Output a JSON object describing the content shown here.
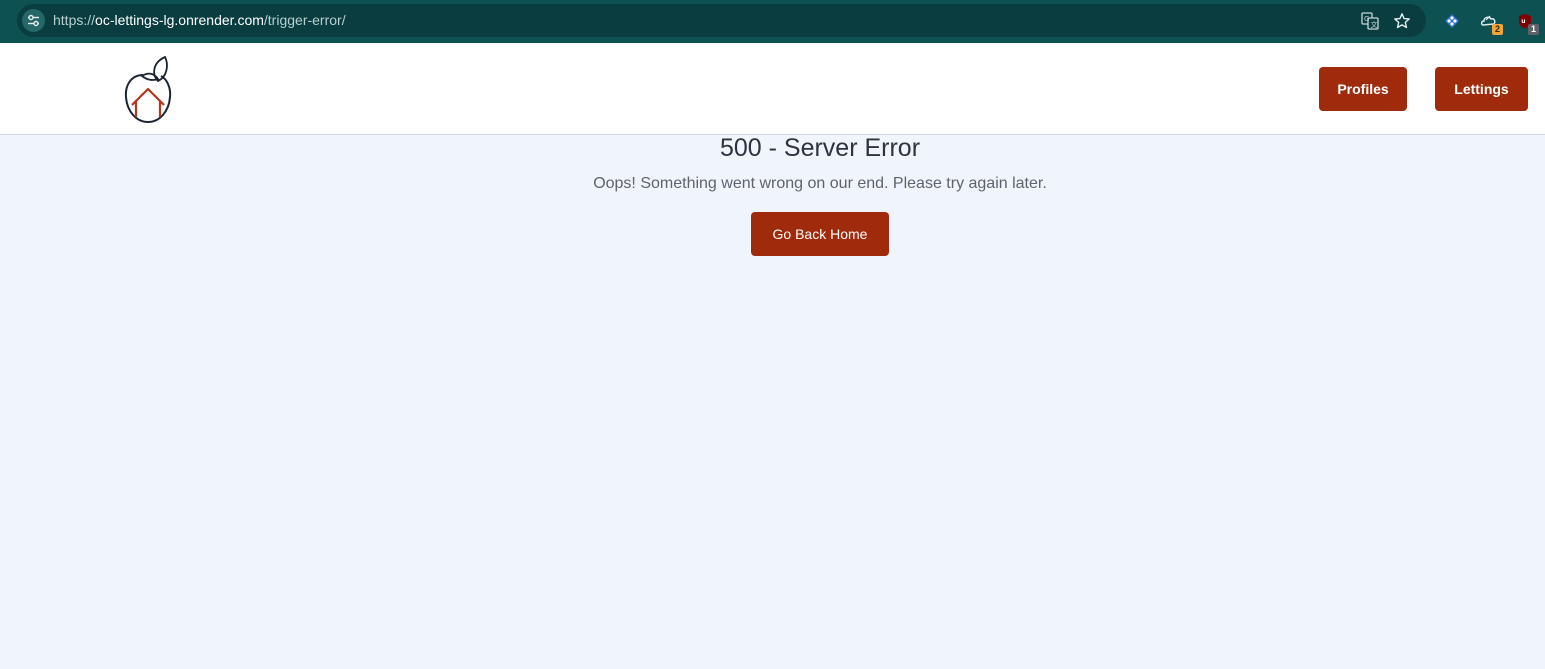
{
  "browser": {
    "url_protocol": "https://",
    "url_host": "oc-lettings-lg.onrender.com",
    "url_path": "/trigger-error/",
    "extensions": [
      {
        "icon": "puzzle-diamond-icon",
        "badge": ""
      },
      {
        "icon": "feather-cloud-icon",
        "badge": "2"
      },
      {
        "icon": "shield-ublock-icon",
        "badge": "1"
      }
    ]
  },
  "header": {
    "nav_profiles": "Profiles",
    "nav_lettings": "Lettings"
  },
  "main": {
    "title": "500 - Server Error",
    "message": "Oops! Something went wrong on our end. Please try again later.",
    "home_button": "Go Back Home"
  },
  "colors": {
    "accent": "#9f2a0c",
    "browser_bar": "#0d5153",
    "page_background": "#f0f4fb"
  }
}
